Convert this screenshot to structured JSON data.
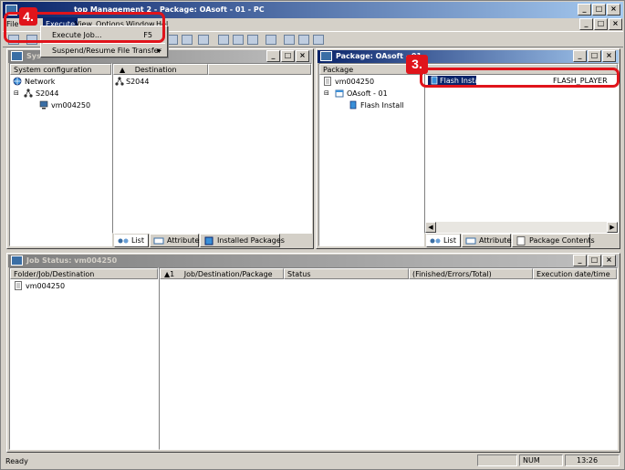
{
  "app": {
    "title_visible": "top Management 2 - Package: OAsoft - 01 - PC"
  },
  "menubar": {
    "file": "File",
    "execute": "Execute",
    "view": "View",
    "options": "Options",
    "window": "Window",
    "help": "Hel"
  },
  "execute_menu": {
    "execute_job": "Execute Job...",
    "execute_job_shortcut": "F5",
    "suspend_resume": "Suspend/Resume File Transfer"
  },
  "system_window": {
    "title": "Syste",
    "tree_header": "System configuration",
    "tree": {
      "network": "Network",
      "s2044": "S2044",
      "vm": "vm004250"
    },
    "list_header_sort": "▲",
    "list_header": "Destination",
    "list_items": [
      "S2044"
    ],
    "tabs": [
      "List",
      "Attributes",
      "Installed Packages"
    ]
  },
  "package_window": {
    "title": "Package: OAsoft - 01",
    "tree_header": "Package",
    "tree": {
      "vm": "vm004250",
      "oasoft": "OAsoft - 01",
      "flash": "Flash Install"
    },
    "list_row": {
      "name": "Flash Install",
      "value": "FLASH_PLAYER"
    },
    "tabs": [
      "List",
      "Attributes",
      "Package Contents"
    ]
  },
  "job_window": {
    "title": "Job Status: vm004250",
    "tree_header": "Folder/Job/Destination",
    "tree_item": "vm004250",
    "sort_col": "▲1",
    "columns": [
      "Job/Destination/Package",
      "Status",
      "(Finished/Errors/Total)",
      "Execution date/time"
    ]
  },
  "callouts": {
    "step4": "4.",
    "step3": "3."
  },
  "statusbar": {
    "left": "Ready",
    "num": "NUM",
    "time": "13:26"
  },
  "colors": {
    "callout_red": "#e0141b",
    "title_active": "#0a246a",
    "title_inactive": "#808080",
    "selection": "#0a246a"
  }
}
